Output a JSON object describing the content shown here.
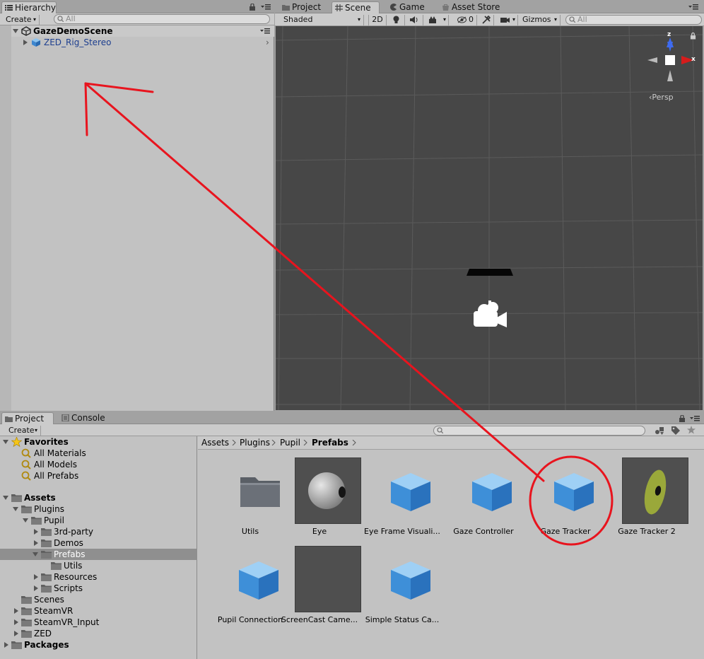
{
  "hierarchy": {
    "tab_label": "Hierarchy",
    "create_label": "Create",
    "search_placeholder": "All",
    "scene_name": "GazeDemoScene",
    "child_item": "ZED_Rig_Stereo"
  },
  "scene": {
    "tabs": [
      {
        "label": "Project",
        "icon": "folder-icon"
      },
      {
        "label": "Scene",
        "icon": "grid-icon"
      },
      {
        "label": "Game",
        "icon": "pacman-icon"
      },
      {
        "label": "Asset Store",
        "icon": "store-icon"
      }
    ],
    "shading_mode": "Shaded",
    "mode_2d": "2D",
    "hidden_count": "0",
    "gizmos_label": "Gizmos",
    "search_placeholder": "All",
    "persp_label": "Persp",
    "axis_z": "z",
    "axis_x": "x"
  },
  "project": {
    "tabs": [
      {
        "label": "Project",
        "icon": "folder-icon"
      },
      {
        "label": "Console",
        "icon": "console-icon"
      }
    ],
    "create_label": "Create",
    "favorites_label": "Favorites",
    "favorites": [
      "All Materials",
      "All Models",
      "All Prefabs"
    ],
    "assets_label": "Assets",
    "tree": {
      "plugins": "Plugins",
      "pupil": "Pupil",
      "third_party": "3rd-party",
      "demos": "Demos",
      "prefabs": "Prefabs",
      "utils": "Utils",
      "resources": "Resources",
      "scripts": "Scripts",
      "scenes": "Scenes",
      "steamvr": "SteamVR",
      "steamvr_input": "SteamVR_Input",
      "zed": "ZED",
      "packages": "Packages"
    },
    "breadcrumb": [
      "Assets",
      "Plugins",
      "Pupil",
      "Prefabs"
    ],
    "assets": [
      {
        "name": "Utils",
        "kind": "folder"
      },
      {
        "name": "Eye",
        "kind": "sphere"
      },
      {
        "name": "Eye Frame Visuali...",
        "kind": "cube"
      },
      {
        "name": "Gaze Controller",
        "kind": "cube"
      },
      {
        "name": "Gaze Tracker",
        "kind": "cube"
      },
      {
        "name": "Gaze Tracker 2",
        "kind": "disc"
      },
      {
        "name": "Pupil Connection",
        "kind": "cube"
      },
      {
        "name": "ScreenCast Came...",
        "kind": "dark"
      },
      {
        "name": "Simple Status Ca...",
        "kind": "cube"
      }
    ]
  },
  "colors": {
    "annotation": "#e8141e",
    "scene_bg": "#474747",
    "panel_bg": "#c2c2c2"
  }
}
